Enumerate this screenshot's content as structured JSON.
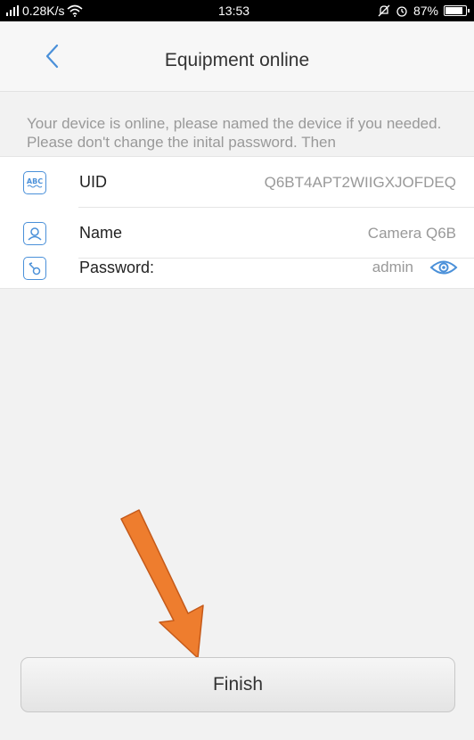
{
  "status_bar": {
    "network_speed": "0.28K/s",
    "time": "13:53",
    "battery_percent": "87%",
    "battery_level": 0.87
  },
  "header": {
    "title": "Equipment online"
  },
  "info_text": "Your device is online, please named the device if you needed. Please don't change the inital password. Then",
  "fields": {
    "uid": {
      "icon": "abc-icon",
      "label": "UID",
      "value": "Q6BT4APT2WIIGXJOFDEQ"
    },
    "name": {
      "icon": "person-icon",
      "label": "Name",
      "value": "Camera Q6B"
    },
    "password": {
      "icon": "key-icon",
      "label": "Password:",
      "value": "admin"
    }
  },
  "finish_label": "Finish",
  "colors": {
    "accent": "#4a90d9",
    "annotation_arrow": "#ee7d2e"
  }
}
